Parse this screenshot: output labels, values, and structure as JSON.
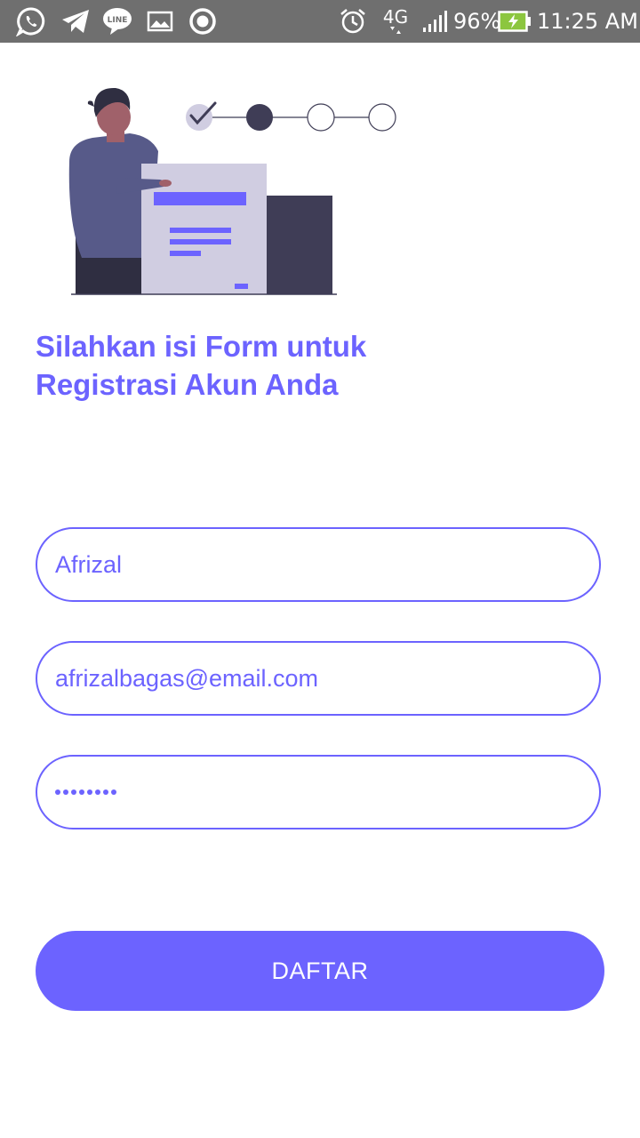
{
  "status_bar": {
    "notification_icons": [
      "whatsapp-icon",
      "telegram-icon",
      "line-icon",
      "gallery-icon",
      "record-icon"
    ],
    "network": "4G",
    "battery_percent": "96%",
    "time": "11:25 AM"
  },
  "progress_steps": {
    "total": 4,
    "completed": 1,
    "current": 2
  },
  "title": {
    "line1": "Silahkan isi Form untuk",
    "line2": "Registrasi Akun Anda"
  },
  "form": {
    "name_value": "Afrizal",
    "email_value": "afrizalbagas@email.com",
    "password_length": 8
  },
  "submit_label": "DAFTAR",
  "colors": {
    "accent": "#6c63ff",
    "status_bar": "#6f6f6f",
    "dark_navy": "#3f3d56",
    "light_grey": "#d0cde1"
  }
}
